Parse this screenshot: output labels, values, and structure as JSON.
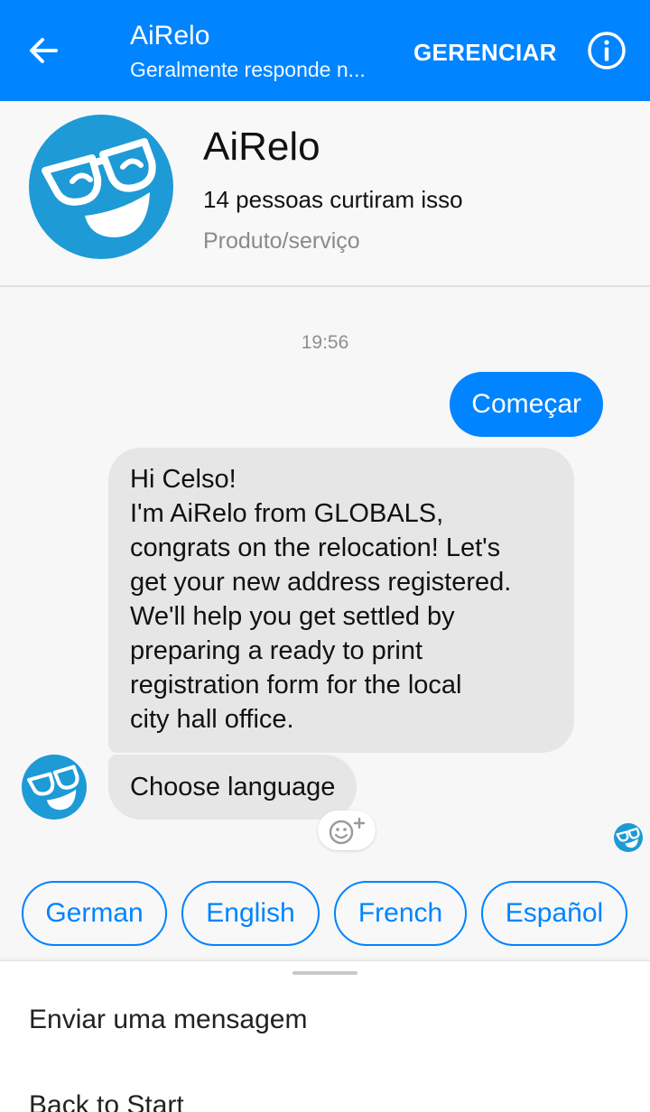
{
  "header": {
    "title": "AiRelo",
    "subtitle": "Geralmente responde n...",
    "manage_label": "GERENCIAR",
    "accent_color": "#0084ff"
  },
  "profile": {
    "name": "AiRelo",
    "likes": "14 pessoas curtiram isso",
    "category": "Produto/serviço"
  },
  "conversation": {
    "timestamp": "19:56",
    "outgoing": "Começar",
    "incoming_lines": [
      "Hi Celso!",
      "I'm AiRelo from GLOBALS,",
      "congrats on the relocation! Let's",
      "get your new address registered.",
      "We'll help you get settled by",
      "preparing a ready to print",
      "registration form for the local",
      "city hall office."
    ],
    "incoming_2": "Choose language"
  },
  "quick_replies": [
    "German",
    "English",
    "French",
    "Español"
  ],
  "bottom_sheet": {
    "items": [
      "Enviar uma mensagem",
      "Back to Start"
    ]
  },
  "icons": {
    "back": "arrow-left-icon",
    "info": "info-icon",
    "react": "smiley-plus-icon",
    "avatar": "glasses-smiley-avatar"
  }
}
